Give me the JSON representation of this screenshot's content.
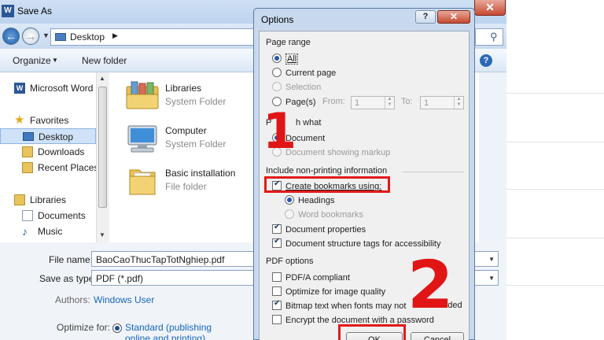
{
  "save_as": {
    "title": "Save As",
    "word_icon": "W",
    "close_label": "✕",
    "address": {
      "location": "Desktop"
    },
    "toolbar": {
      "organize": "Organize",
      "new_folder": "New folder",
      "help": "?"
    },
    "nav": {
      "word": "Microsoft Word",
      "favorites": "Favorites",
      "desktop": "Desktop",
      "downloads": "Downloads",
      "recent_places": "Recent Places",
      "libraries": "Libraries",
      "documents": "Documents",
      "music": "Music"
    },
    "files": [
      {
        "name": "Libraries",
        "type": "System Folder",
        "icon": "libraries-folder-icon"
      },
      {
        "name": "Computer",
        "type": "System Folder",
        "icon": "computer-icon"
      },
      {
        "name": "Basic installation",
        "type": "File folder",
        "icon": "folder-icon"
      }
    ],
    "bottom": {
      "file_name_label": "File name:",
      "file_name_value": "BaoCaoThucTapTotNghiep.pdf",
      "save_as_type_label": "Save as type:",
      "save_as_type_value": "PDF (*.pdf)",
      "authors_label": "Authors:",
      "authors_value": "Windows User",
      "optimize_label": "Optimize for:",
      "optimize_option": "Standard (publishing online and printing)"
    }
  },
  "options": {
    "title": "Options",
    "help_label": "?",
    "close_label": "✕",
    "page_range": {
      "heading": "Page range",
      "all": "All",
      "current_page": "Current page",
      "selection": "Selection",
      "pages": "Page(s)",
      "from_label": "From:",
      "from_value": "1",
      "to_label": "To:",
      "to_value": "1"
    },
    "publish_what": {
      "heading_left": "P",
      "heading_right": "h what",
      "document": "Document",
      "document_markup": "Document showing markup"
    },
    "non_printing": {
      "heading": "Include non-printing information",
      "create_bookmarks": "Create bookmarks using:",
      "headings": "Headings",
      "word_bookmarks": "Word bookmarks",
      "doc_properties": "Document properties",
      "structure_tags": "Document structure tags for accessibility"
    },
    "pdf_options": {
      "heading": "PDF options",
      "pdfa": "PDF/A compliant",
      "optimize_image": "Optimize for image quality",
      "bitmap_text_left": "Bitmap text when fonts may not",
      "bitmap_text_right": "edded",
      "encrypt": "Encrypt the document with a password"
    },
    "buttons": {
      "ok": "OK",
      "cancel": "Cancel"
    }
  },
  "annotations": {
    "step1": "1",
    "step2": "2",
    "color": "#e11515"
  }
}
